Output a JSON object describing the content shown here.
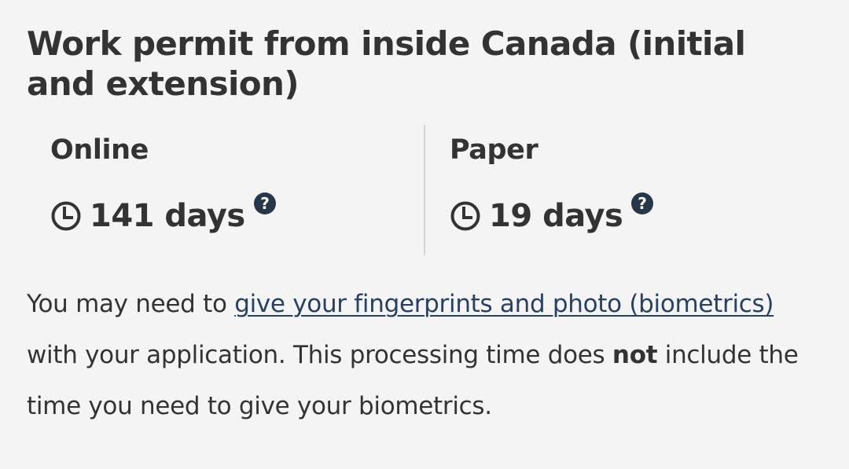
{
  "title": "Work permit from inside Canada (initial and extension)",
  "methods": [
    {
      "label": "Online",
      "time": "141 days",
      "icon": "clock-icon",
      "help_icon": "question-circle-icon"
    },
    {
      "label": "Paper",
      "time": "19 days",
      "icon": "clock-icon",
      "help_icon": "question-circle-icon"
    }
  ],
  "note": {
    "prefix": "You may need to ",
    "link_text": "give your fingerprints and photo (biometrics)",
    "middle": " with your application. This processing time does ",
    "emphasis": "not",
    "suffix": " include the time you need to give your biometrics."
  },
  "colors": {
    "background": "#f4f4f4",
    "text": "#333333",
    "link": "#284162",
    "help_icon": "#26374a",
    "divider": "#d4d4d4"
  }
}
